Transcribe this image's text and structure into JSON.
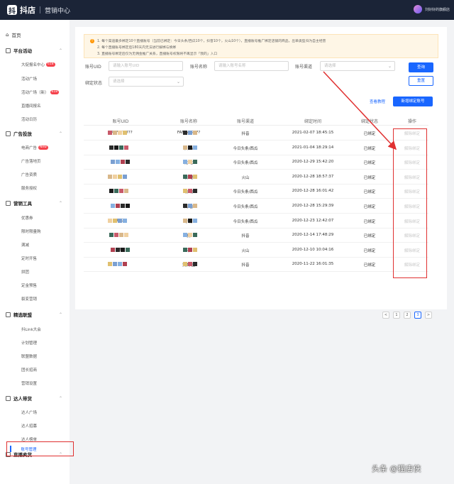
{
  "topbar": {
    "logo_mark": "抖",
    "app_name": "抖店",
    "section": "营销中心",
    "user_name": "刘好好的旗舰店"
  },
  "sidebar": {
    "home": "首页",
    "groups": [
      {
        "label": "平台活动",
        "items": [
          {
            "label": "大促报名中心",
            "badge": "618"
          },
          {
            "label": "活动广场"
          },
          {
            "label": "活动广场（新）",
            "badge": "618"
          },
          {
            "label": "直播间报名"
          },
          {
            "label": "活动日历"
          }
        ]
      },
      {
        "label": "广告投放",
        "items": [
          {
            "label": "电商广告",
            "badge": "New"
          },
          {
            "label": "广告落地页"
          },
          {
            "label": "广告资质"
          },
          {
            "label": "服务授权"
          }
        ]
      },
      {
        "label": "营销工具",
        "items": [
          {
            "label": "优惠券"
          },
          {
            "label": "限时限量购"
          },
          {
            "label": "满减"
          },
          {
            "label": "定时开售"
          },
          {
            "label": "拼团"
          },
          {
            "label": "定金预售"
          },
          {
            "label": "裂变营销"
          }
        ]
      },
      {
        "label": "精选联盟",
        "items": [
          {
            "label": "抖Link大会"
          },
          {
            "label": "计划管理"
          },
          {
            "label": "联盟数据"
          },
          {
            "label": "团长招商"
          },
          {
            "label": "营销设置"
          }
        ]
      },
      {
        "label": "达人带货",
        "items": [
          {
            "label": "达人广场"
          },
          {
            "label": "达人招募"
          },
          {
            "label": "达人榜单"
          }
        ]
      },
      {
        "label": "直播卖货",
        "items": []
      }
    ],
    "active_item": "账号管理"
  },
  "notice": [
    "1. 每个渠道最多绑定10个直播账号（当前已绑定：今日头条/西瓜10个，抖音10个，火山10个），直播账号推广绑定店铺的商品，出单类型归为自主经营",
    "2. 每个直播账号绑定后180天内无法进行解绑与换绑",
    "3. 直播账号绑定后仅为无佣金推广关系，直播账号权限将不再显示「我的」入口"
  ],
  "filters": {
    "uid_label": "账号UID",
    "uid_placeholder": "请输入账号UID",
    "name_label": "账号名称",
    "name_placeholder": "请输入账号名称",
    "channel_label": "账号渠道",
    "channel_placeholder": "请选择",
    "status_label": "绑定状态",
    "status_placeholder": "请选择",
    "query_button": "查询",
    "reset_button": "重置"
  },
  "actions": {
    "tutorial_link": "查看教程",
    "add_button": "新增绑定账号"
  },
  "table": {
    "headers": [
      "账号UID",
      "账号名称",
      "账号渠道",
      "绑定时间",
      "绑定状态",
      "操作"
    ],
    "rows": [
      {
        "uid": "94?????????",
        "name": "FAN  NG????",
        "channel": "抖音",
        "time": "2021-02-07 18:45:15",
        "status": "已绑定",
        "op": "解除绑定"
      },
      {
        "uid": "5",
        "name": "长    se",
        "channel": "今日头条/西瓜",
        "time": "2021-01-04 18:29:14",
        "status": "已绑定",
        "op": "解除绑定"
      },
      {
        "uid": "",
        "name": "龙    七",
        "channel": "今日头条/西瓜",
        "time": "2020-12-29 15:42:20",
        "status": "已绑定",
        "op": "解除绑定"
      },
      {
        "uid": "",
        "name": "囊   吧",
        "channel": "火山",
        "time": "2020-12-28 18:57:37",
        "status": "已绑定",
        "op": "解除绑定"
      },
      {
        "uid": "",
        "name": "瑜   瑜",
        "channel": "今日头条/西瓜",
        "time": "2020-12-28 16:01:42",
        "status": "已绑定",
        "op": "解除绑定"
      },
      {
        "uid": "",
        "name": "萬   香",
        "channel": "今日头条/西瓜",
        "time": "2020-12-28 15:29:39",
        "status": "已绑定",
        "op": "解除绑定"
      },
      {
        "uid": "78223",
        "name": "小青",
        "channel": "今日头条/西瓜",
        "time": "2020-12-23 12:42:07",
        "status": "已绑定",
        "op": "解除绑定"
      },
      {
        "uid": "",
        "name": "要",
        "channel": "抖音",
        "time": "2020-12-14 17:48:29",
        "status": "已绑定",
        "op": "解除绑定"
      },
      {
        "uid": "6",
        "name": "不",
        "channel": "火山",
        "time": "2020-12-10 10:04:16",
        "status": "已绑定",
        "op": "解除绑定"
      },
      {
        "uid": "",
        "name": "爱美     园",
        "channel": "抖音",
        "time": "2020-11-22 16:01:35",
        "status": "已绑定",
        "op": "解除绑定"
      }
    ]
  },
  "pagination": {
    "prev": "<",
    "pages": [
      "1",
      "2",
      "3"
    ],
    "current": "3",
    "next": ">"
  },
  "watermark": "头条 @猫店侠",
  "colors": {
    "primary": "#1966ff",
    "annotation_red": "#e03030",
    "topbar": "#1b2437",
    "badge": "#f5414b"
  }
}
